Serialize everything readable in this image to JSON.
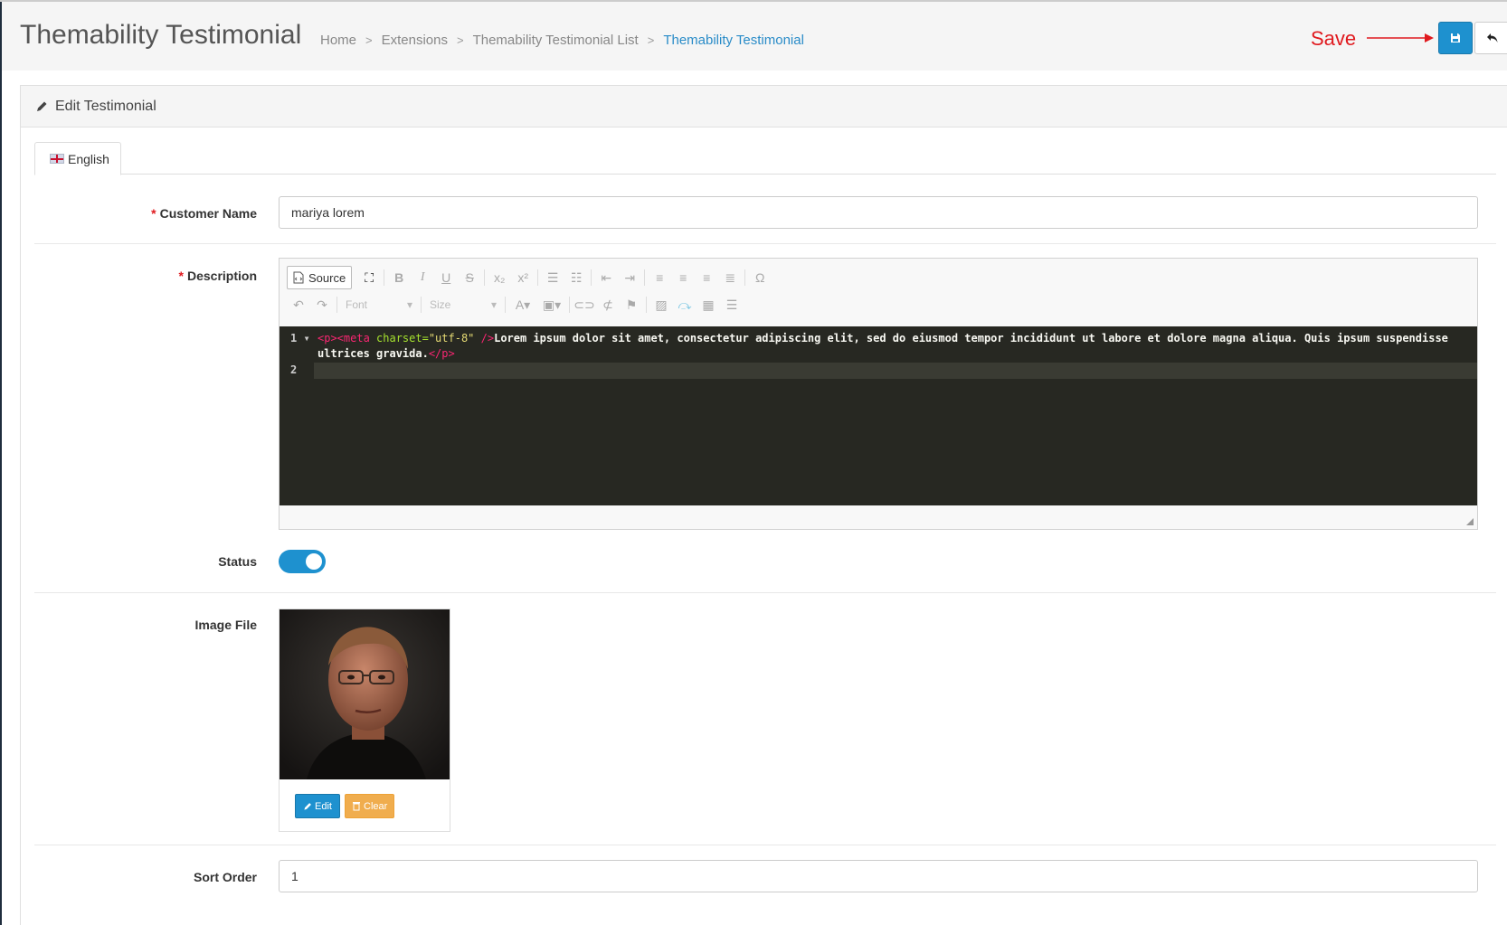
{
  "header": {
    "title": "Themability Testimonial",
    "breadcrumb": [
      "Home",
      "Extensions",
      "Themability Testimonial List",
      "Themability Testimonial"
    ],
    "save_annotation": "Save"
  },
  "panel": {
    "heading": "Edit Testimonial"
  },
  "tabs": [
    {
      "label": "English"
    }
  ],
  "form": {
    "customer_name": {
      "label": "Customer Name",
      "required": "*",
      "value": "mariya lorem"
    },
    "description": {
      "label": "Description",
      "required": "*",
      "toolbar": {
        "source_label": "Source",
        "font_label": "Font",
        "size_label": "Size"
      },
      "code": {
        "line1_num": "1",
        "line2_num": "2",
        "tag_open": "<p><meta",
        "attr": "charset=",
        "str": "\"utf-8\"",
        "tag_close": " />",
        "text1": "Lorem ipsum dolor sit amet, consectetur adipiscing elit, sed do eiusmod tempor incididunt ut labore et dolore magna aliqua. Quis ipsum suspendisse",
        "text2": "ultrices gravida.",
        "tag_end": "</p>"
      }
    },
    "status": {
      "label": "Status",
      "enabled": true
    },
    "image_file": {
      "label": "Image File",
      "edit_label": "Edit",
      "clear_label": "Clear"
    },
    "sort_order": {
      "label": "Sort Order",
      "value": "1"
    }
  },
  "colors": {
    "primary": "#1e91cf",
    "warning": "#f0ad4e",
    "required": "#e0191e",
    "annotation": "#e0191e"
  }
}
